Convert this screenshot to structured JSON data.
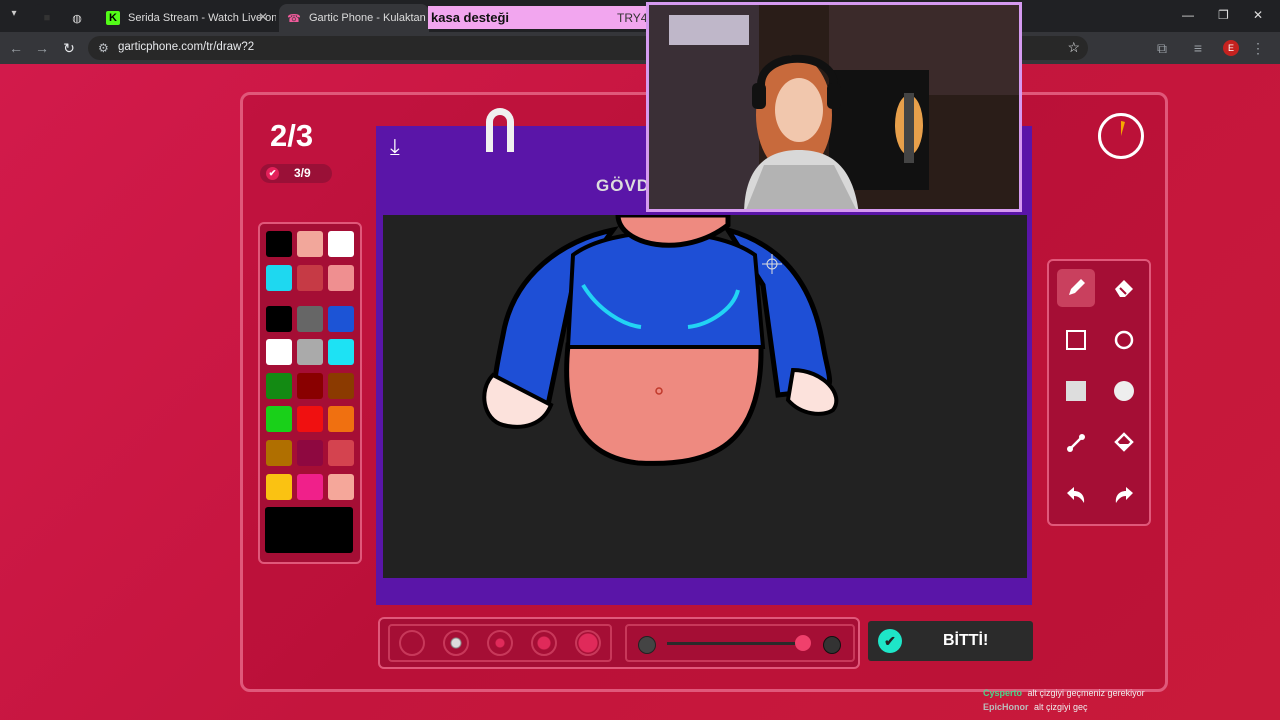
{
  "browser": {
    "tabs": [
      {
        "title": "Serida Stream - Watch Live on K",
        "icon": "kick-icon"
      },
      {
        "title": "Gartic Phone - Kulaktan Kulağa",
        "icon": "phone-icon"
      }
    ],
    "url": "garticphone.com/tr/draw?2",
    "profile_initial": "E"
  },
  "overlay": {
    "title": "kasa desteği",
    "code": "TRY4"
  },
  "game": {
    "round": "2/3",
    "done_count": "3/9",
    "word_partial": "GÖVD",
    "done_button": "BİTTİ!",
    "palette_colors": [
      "#000000",
      "#f2a79b",
      "#ffffff",
      "#1ed8f0",
      "#c63a45",
      "#ef8f90",
      "#000000",
      "#666666",
      "#1c54d6",
      "#ffffff",
      "#aaaaaa",
      "#1de2f4",
      "#138a13",
      "#890000",
      "#8b3a00",
      "#19d019",
      "#f01010",
      "#f07010",
      "#b06f00",
      "#8e0840",
      "#d4434f",
      "#fac212",
      "#f0208a",
      "#f5a79a"
    ],
    "current_color": "#000000",
    "tools": [
      "pencil-icon",
      "eraser-icon",
      "rectangle-icon",
      "circle-icon",
      "filled-rectangle-icon",
      "filled-circle-icon",
      "line-icon",
      "fill-bucket-icon",
      "undo-icon",
      "redo-icon"
    ]
  },
  "chat": [
    {
      "user": "Cysperto",
      "message": "alt çizgiyi geçmeniz gerekiyor"
    },
    {
      "user": "EpicHonor",
      "message": "alt çizgiyi geç"
    }
  ]
}
